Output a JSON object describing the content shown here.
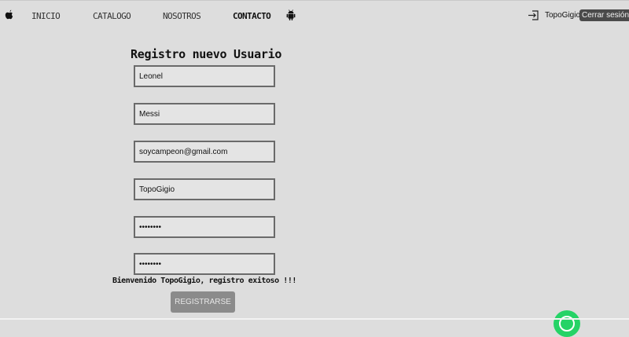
{
  "nav": {
    "brand_icon": "apple-icon",
    "items": [
      "INICIO",
      "CATALOGO",
      "NOSOTROS",
      "CONTACTO"
    ],
    "active": "CONTACTO",
    "extra_icon": "android-icon",
    "login_icon": "login-arrow-icon",
    "username": "TopoGigio",
    "logout_label": "Cerrar sesión"
  },
  "form": {
    "title": "Registro nuevo Usuario",
    "fields": [
      {
        "name": "nombre",
        "value": "Leonel"
      },
      {
        "name": "apellido",
        "value": "Messi"
      },
      {
        "name": "email",
        "value": "soycampeon@gmail.com"
      },
      {
        "name": "usuario",
        "value": "TopoGigio"
      },
      {
        "name": "password",
        "value": "••••••••"
      },
      {
        "name": "confirm_password",
        "value": "••••••••"
      }
    ],
    "success_message": "Bienvenido TopoGigio, registro exitoso !!!",
    "submit_label": "REGISTRARSE"
  },
  "floating": {
    "icon": "whatsapp-icon",
    "color": "#25d366"
  },
  "colors": {
    "background": "#dddddd",
    "input_border": "#6a6a6a",
    "button": "#8b8b8b",
    "logout_bg": "#4a4a4a"
  }
}
